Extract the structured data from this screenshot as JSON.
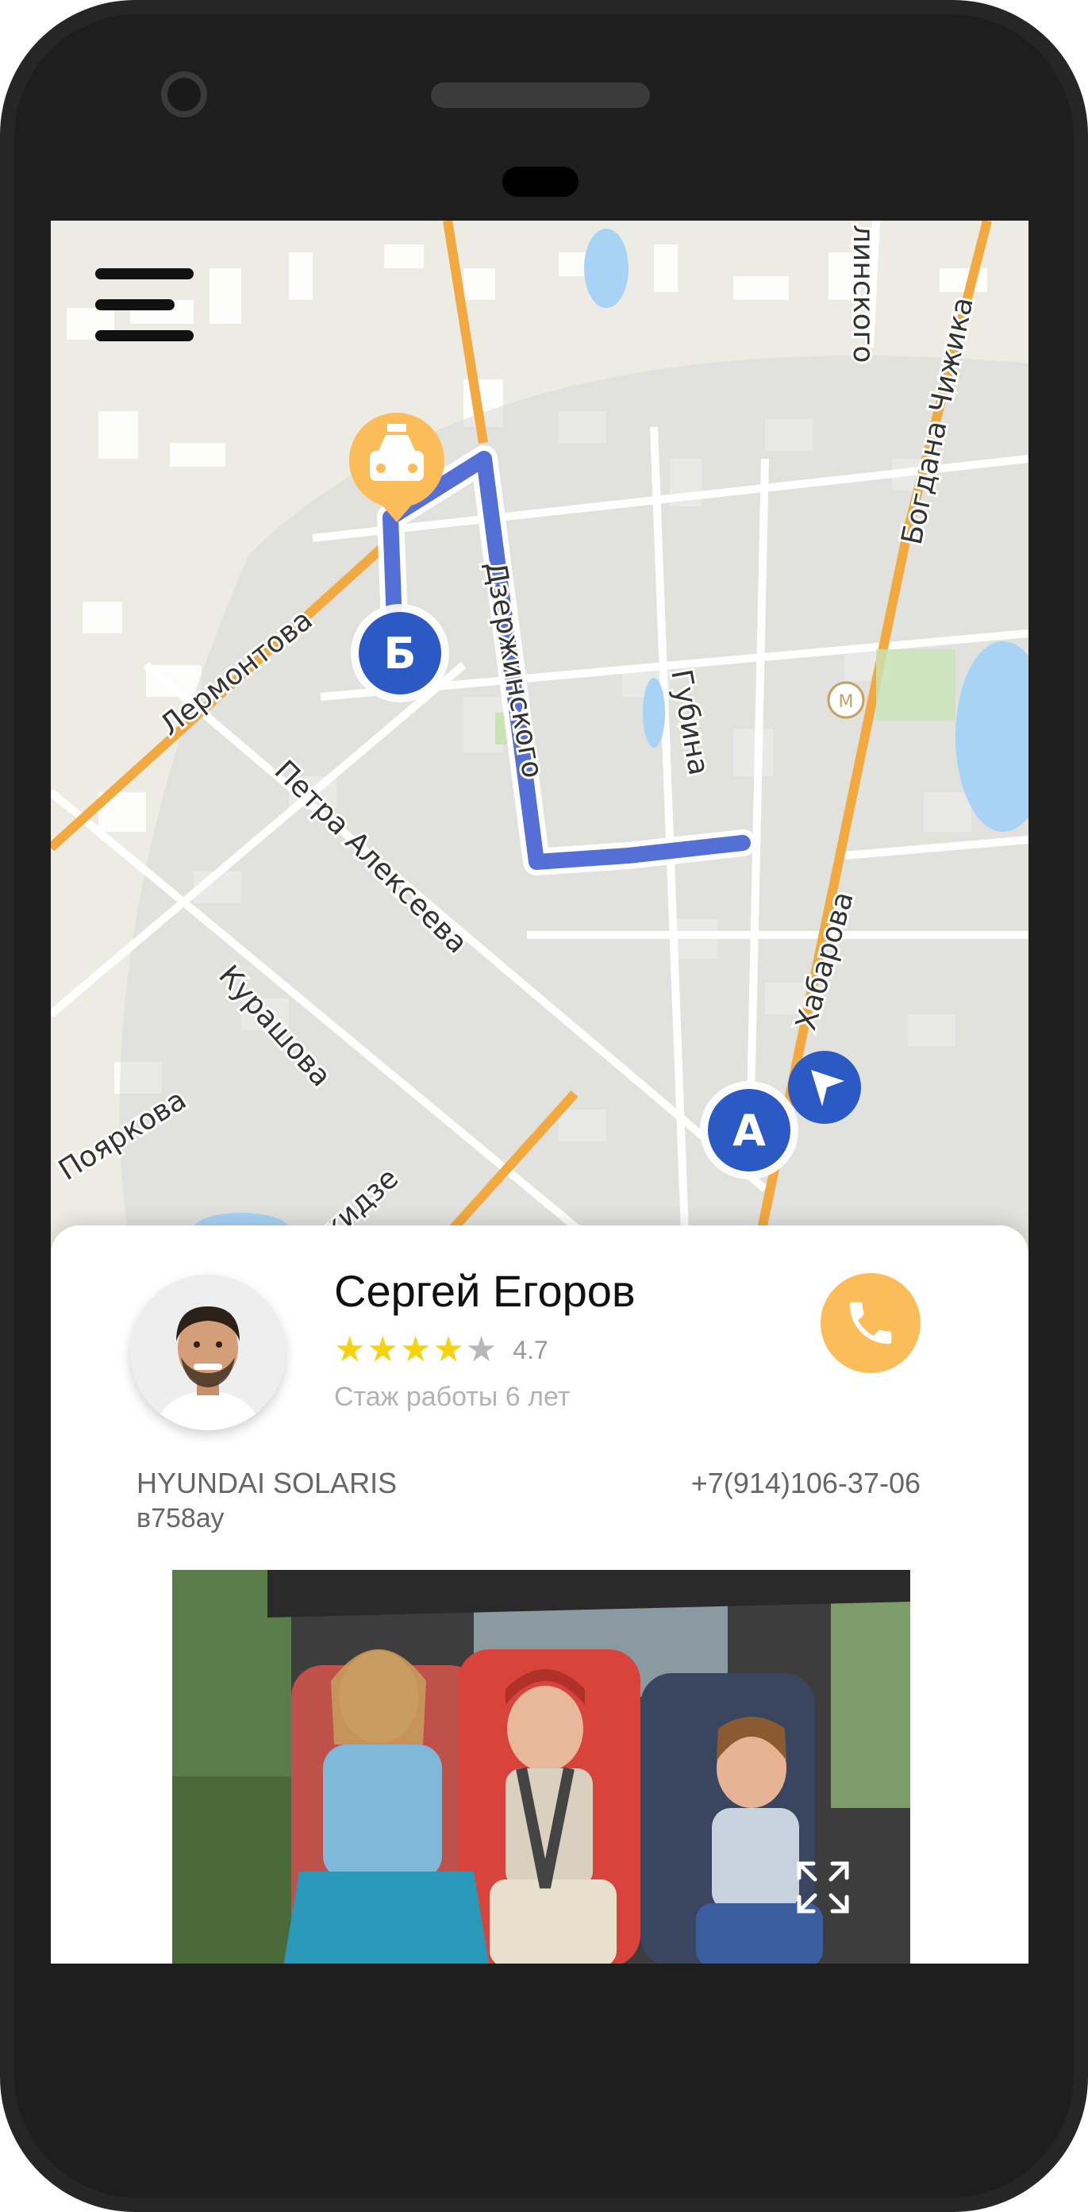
{
  "map": {
    "streets": [
      "Дзержинского",
      "Лермонтова",
      "Петра Алексеева",
      "Курашова",
      "Пояркова",
      "Губина",
      "Хабарова",
      "Богдана Чижика",
      "линского",
      "икидзе"
    ],
    "markers": {
      "start": "А",
      "end": "Б"
    },
    "taxi_icon": "taxi-icon",
    "navigation_icon": "navigation-arrow-icon",
    "colors": {
      "route": "#5470d6",
      "marker": "#2c5ac4",
      "taxi": "#fbbd5a",
      "map_bg": "#ecebe4"
    }
  },
  "driver": {
    "name": "Сергей Егоров",
    "rating_value": "4.7",
    "stars_filled": 4,
    "stars_total": 5,
    "experience": "Стаж работы 6 лет",
    "avatar_icon": "driver-avatar"
  },
  "car": {
    "model": "HYUNDAI  SOLARIS",
    "plate": "в758ау",
    "phone": "+7(914)106-37-06"
  },
  "actions": {
    "call_icon": "phone-icon",
    "menu_icon": "hamburger-menu-icon",
    "expand_icon": "expand-icon"
  }
}
